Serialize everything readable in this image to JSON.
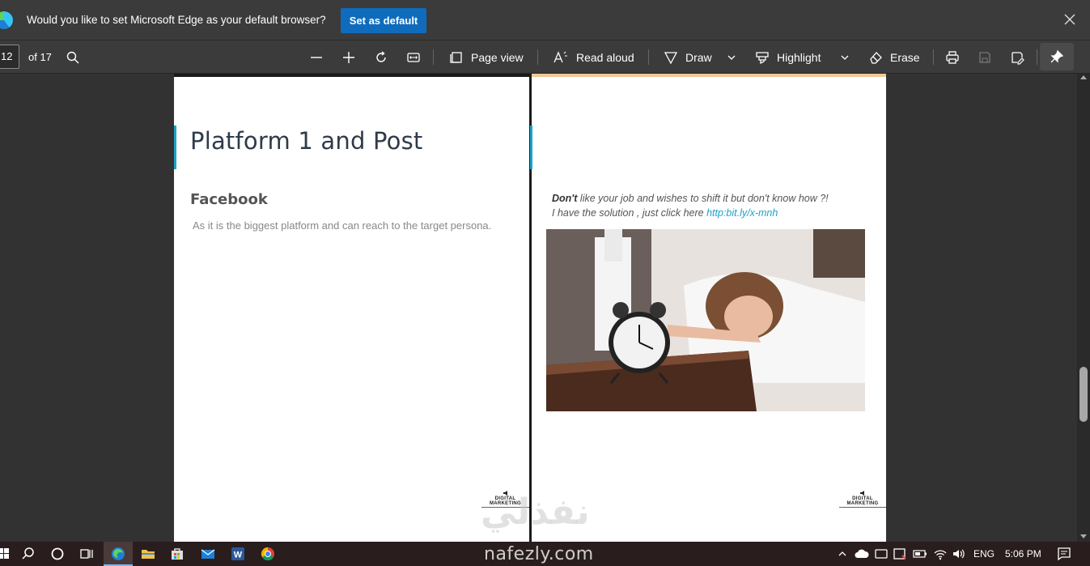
{
  "notification": {
    "message": "Would you like to set Microsoft Edge as your default browser?",
    "set_default_label": "Set as default"
  },
  "toolbar": {
    "page_number": "12",
    "page_total": "of 17",
    "page_view": "Page view",
    "read_aloud": "Read aloud",
    "draw": "Draw",
    "highlight": "Highlight",
    "erase": "Erase"
  },
  "left_page": {
    "title": "Platform 1 and Post",
    "subtitle": "Facebook",
    "body": "As it is the biggest platform and can reach to the target persona.",
    "brand": "DIGITAL MARKETING"
  },
  "right_page": {
    "promo_bold": "Don't",
    "promo_line1": "like your job and wishes to shift it but don't know how  ?!",
    "promo_line2": "I have the solution , just click here ",
    "promo_link": "http:bit.ly/x-mnh",
    "brand": "DIGITAL MARKETING"
  },
  "watermark": {
    "arabic": "نفذلي",
    "latin": "nafezly.com"
  },
  "taskbar": {
    "language": "ENG",
    "time": "5:06 PM"
  },
  "colors": {
    "accent": "#1aa3c7",
    "edge_button": "#0f6cbd",
    "toolbar_bg": "#3b3b3b"
  }
}
